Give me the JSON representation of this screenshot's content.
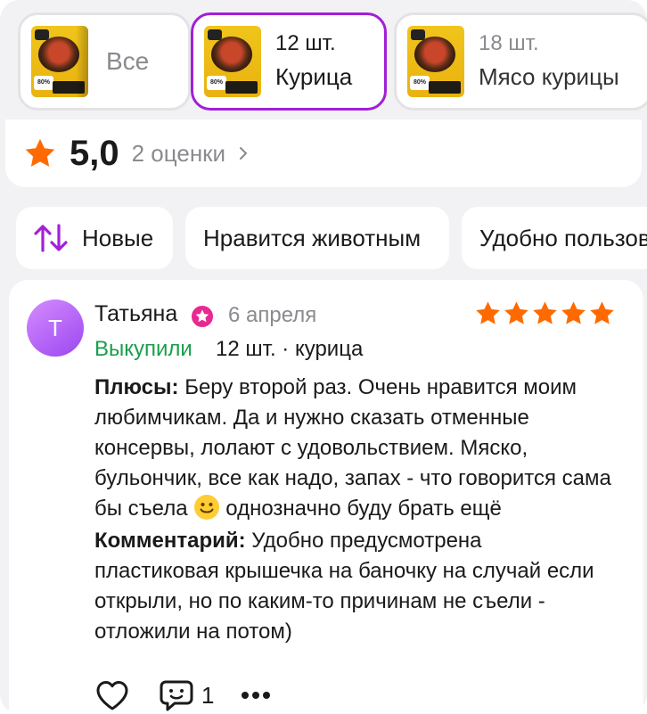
{
  "variants": [
    {
      "label": "Все",
      "count": "",
      "selected": false
    },
    {
      "label": "Курица",
      "count": "12 шт.",
      "selected": true
    },
    {
      "label": "Мясо курицы",
      "count": "18 шт.",
      "selected": false
    }
  ],
  "product_thumb_tag": "80%",
  "rating": {
    "value": "5,0",
    "count_label": "2 оценки"
  },
  "sort_chips": [
    {
      "label": "Новые",
      "icon": "sort-icon"
    },
    {
      "label": "Нравится животным"
    },
    {
      "label": "Удобно пользоваться"
    }
  ],
  "review": {
    "avatar_letter": "Т",
    "author": "Татьяна",
    "date": "6 апреля",
    "stars": 5,
    "bought_label": "Выкупили",
    "variant_info": "12 шт. · курица",
    "pros_label": "Плюсы:",
    "pros_text": "Беру второй раз. Очень нравится моим любимчикам. Да и нужно сказать отменные консервы, лолают с удовольствием. Мяско, бульончик, все как надо, запах - что говорится сама бы съела",
    "pros_tail": "однозначно буду брать ещё",
    "comment_label": "Комментарий:",
    "comment_text": "Удобно предусмотрена пластиковая крышечка на баночку на случай если открыли, но по каким-то причинам не съели - отложили на потом)",
    "comments_count": "1"
  },
  "colors": {
    "accent": "#a21fd8",
    "star": "#ff6a00",
    "bought": "#1a9e4b",
    "badge": "#e8298f"
  }
}
